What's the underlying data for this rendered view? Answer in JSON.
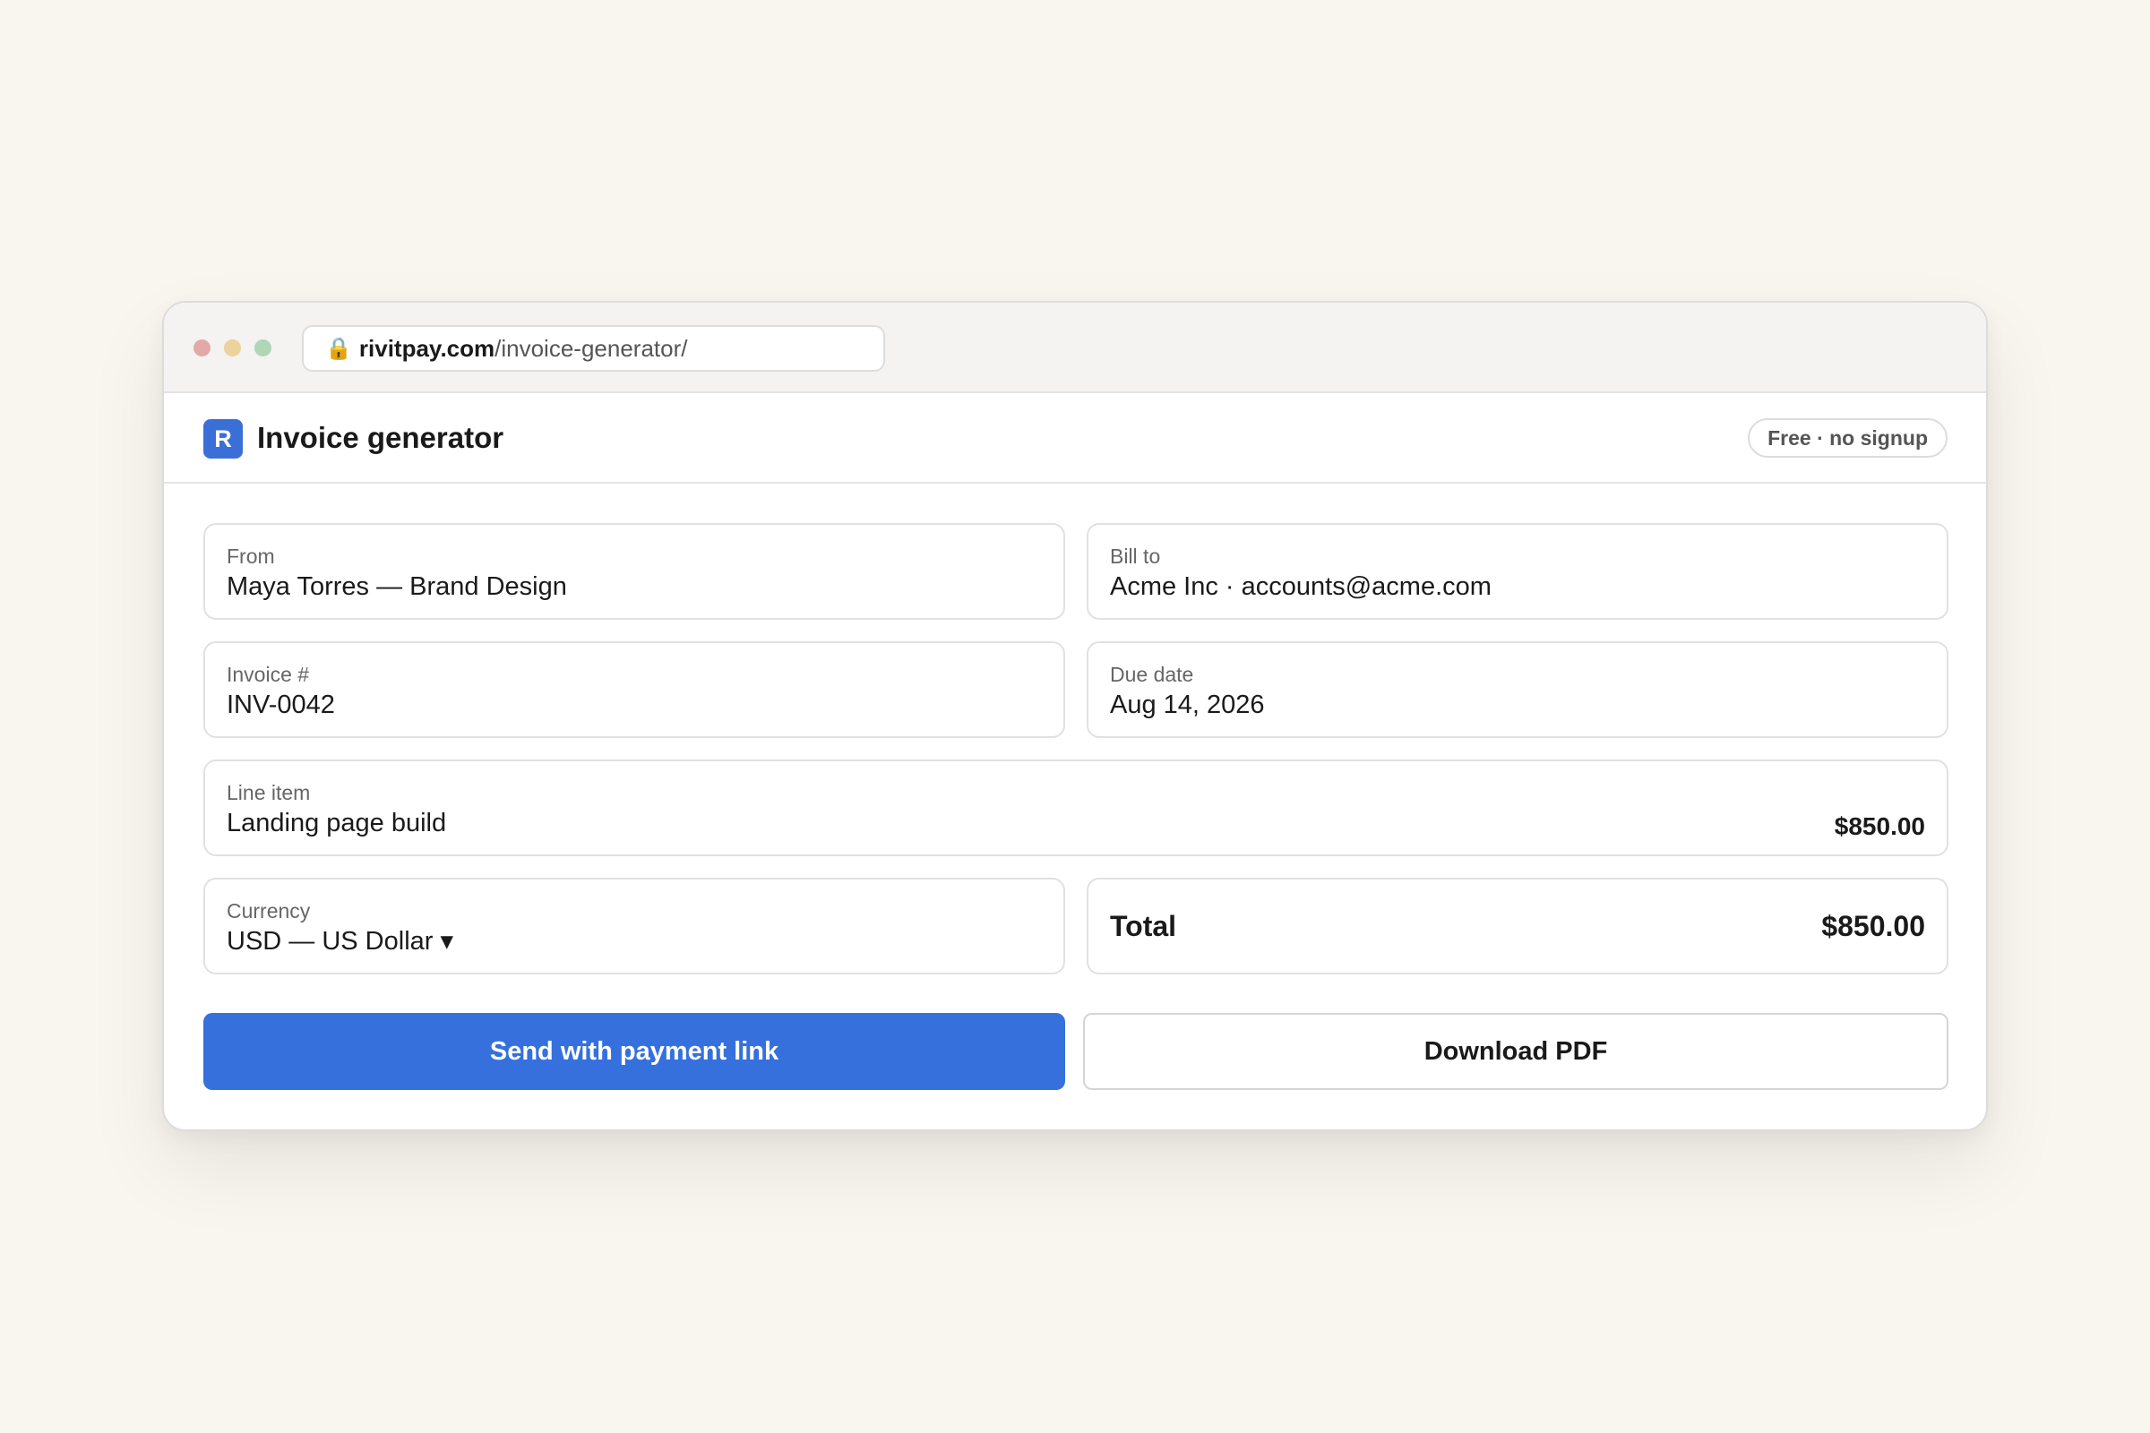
{
  "browser": {
    "url_domain": "rivitpay.com",
    "url_path": "/invoice-generator/",
    "lock_icon": "🔒"
  },
  "app": {
    "logo_letter": "R",
    "title": "Invoice generator",
    "badge": "Free · no signup"
  },
  "form": {
    "from": {
      "label": "From",
      "value": "Maya Torres — Brand Design"
    },
    "bill_to": {
      "label": "Bill to",
      "value": "Acme Inc · accounts@acme.com"
    },
    "invoice_number": {
      "label": "Invoice #",
      "value": "INV-0042"
    },
    "due_date": {
      "label": "Due date",
      "value": "Aug 14, 2026"
    },
    "line_item": {
      "label": "Line item",
      "value": "Landing page build",
      "amount": "$850.00"
    },
    "currency": {
      "label": "Currency",
      "value": "USD — US Dollar ▾"
    },
    "total": {
      "label": "Total",
      "amount": "$850.00"
    }
  },
  "actions": {
    "send_label": "Send with payment link",
    "download_label": "Download PDF"
  },
  "colors": {
    "accent": "#3570dd",
    "background": "#f9f6ef"
  }
}
